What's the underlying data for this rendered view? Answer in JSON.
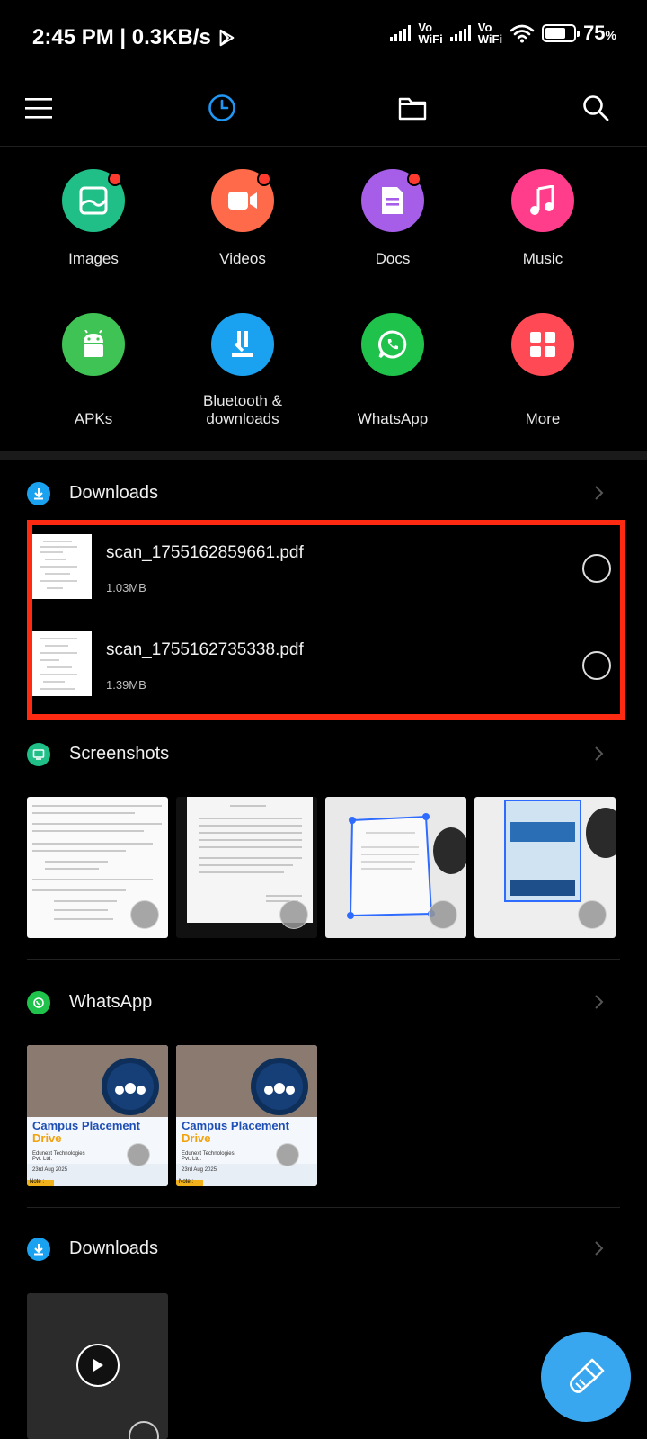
{
  "status_bar": {
    "time_speed": "2:45 PM | 0.3KB/s",
    "wifi_labels": [
      "Vo",
      "WiFi"
    ],
    "battery_percent": "75",
    "battery_suffix": "%",
    "battery_level": 75
  },
  "toolbar": {
    "icons": [
      "menu-icon",
      "recent-clock-icon",
      "folder-icon",
      "search-icon"
    ],
    "accent": "#2196f3"
  },
  "categories": [
    {
      "label": "Images",
      "icon": "image-icon",
      "color": "#1fbf87",
      "badge": true
    },
    {
      "label": "Videos",
      "icon": "video-icon",
      "color": "#ff6b4a",
      "badge": true
    },
    {
      "label": "Docs",
      "icon": "document-icon",
      "color": "#a65ee8",
      "badge": true
    },
    {
      "label": "Music",
      "icon": "music-note-icon",
      "color": "#ff3d8b",
      "badge": false
    },
    {
      "label": "APKs",
      "icon": "android-icon",
      "color": "#3fc354",
      "badge": false
    },
    {
      "label": "Bluetooth & downloads",
      "icon": "download-tray-icon",
      "color": "#1aa2f0",
      "badge": false
    },
    {
      "label": "WhatsApp",
      "icon": "whatsapp-icon",
      "color": "#1fc24b",
      "badge": false
    },
    {
      "label": "More",
      "icon": "grid-icon",
      "color": "#ff4a55",
      "badge": false
    }
  ],
  "sections": {
    "downloads": {
      "title": "Downloads",
      "files": [
        {
          "name": "scan_1755162859661.pdf",
          "size": "1.03MB"
        },
        {
          "name": "scan_1755162735338.pdf",
          "size": "1.39MB"
        }
      ]
    },
    "screenshots": {
      "title": "Screenshots",
      "count": 4
    },
    "whatsapp": {
      "title": "WhatsApp",
      "poster": {
        "headline": "Campus Placement",
        "subline": "Drive",
        "company": "Edunext Technologies Pvt. Ltd.",
        "date": "23rd Aug 2025",
        "note": "Note :"
      }
    },
    "downloads2": {
      "title": "Downloads"
    }
  },
  "colors": {
    "highlight_border": "#ff2a12",
    "fab": "#39a7f0"
  }
}
